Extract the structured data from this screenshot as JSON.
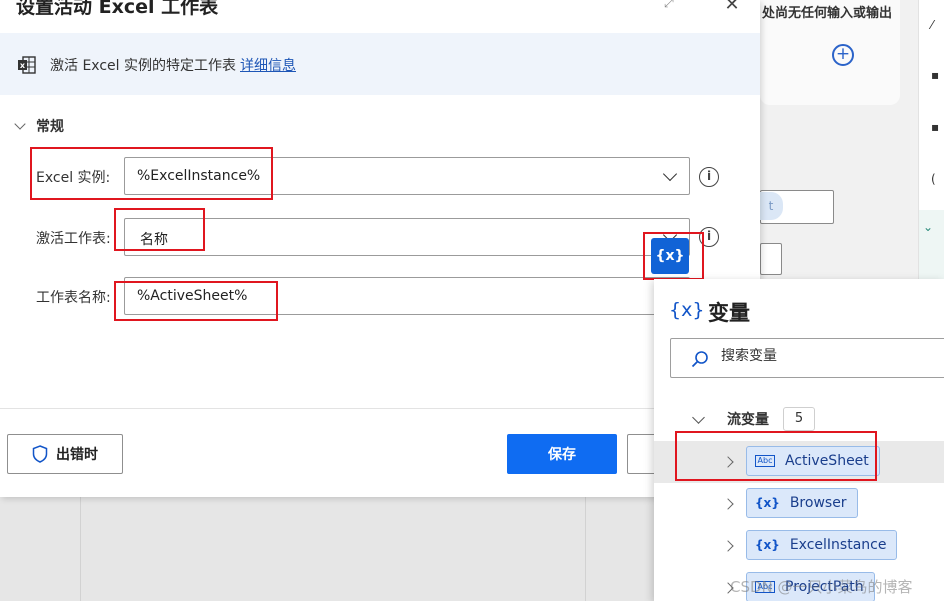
{
  "dialog": {
    "title": "设置活动 Excel 工作表",
    "banner_text": "激活 Excel 实例的特定工作表",
    "banner_link": "详细信息",
    "section_label": "常规"
  },
  "fields": {
    "excel_instance_label": "Excel 实例:",
    "excel_instance_value": "%ExcelInstance%",
    "activate_label": "激活工作表:",
    "activate_value": "名称",
    "sheet_name_label": "工作表名称:",
    "sheet_name_value": "%ActiveSheet%"
  },
  "footer": {
    "on_error_label": "出错时",
    "save_label": "保存"
  },
  "var_button_label": "{x}",
  "variables_panel": {
    "icon_label": "{x}",
    "title": "变量",
    "search_placeholder": "搜索变量",
    "group_label": "流变量",
    "group_count": "5",
    "items": [
      {
        "label": "ActiveSheet",
        "icon": "Abc"
      },
      {
        "label": "Browser",
        "icon": "{x}"
      },
      {
        "label": "ExcelInstance",
        "icon": "{x}"
      },
      {
        "label": "ProjectPath",
        "icon": "Abc"
      }
    ]
  },
  "background": {
    "designer_text": "处尚无任何输入或输出",
    "chip_text": "t"
  },
  "watermark": "CSDN @一只小菜鸟的博客",
  "colors": {
    "accent": "#0f6cf2",
    "highlight": "#e0161f",
    "banner_bg": "#eff4fb"
  }
}
